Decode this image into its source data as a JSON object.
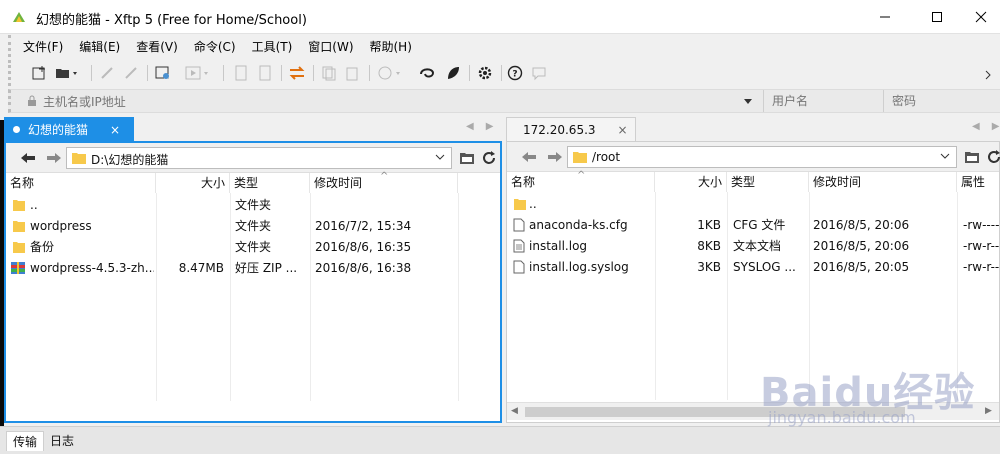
{
  "window": {
    "title": "幻想的能猫 - Xftp 5 (Free for Home/School)"
  },
  "menu": [
    "文件(F)",
    "编辑(E)",
    "查看(V)",
    "命令(C)",
    "工具(T)",
    "窗口(W)",
    "帮助(H)"
  ],
  "address_bar": {
    "host_placeholder": "主机名或IP地址",
    "username_placeholder": "用户名",
    "password_placeholder": "密码"
  },
  "left_pane": {
    "tab_label": "幻想的能猫",
    "tab_close": "×",
    "path": "D:\\幻想的能猫",
    "columns": [
      "名称",
      "大小",
      "类型",
      "修改时间"
    ],
    "files": [
      {
        "name": "..",
        "size": "",
        "type": "文件夹",
        "modified": "",
        "icon": "folder-icon"
      },
      {
        "name": "wordpress",
        "size": "",
        "type": "文件夹",
        "modified": "2016/7/2, 15:34",
        "icon": "folder-icon"
      },
      {
        "name": "备份",
        "size": "",
        "type": "文件夹",
        "modified": "2016/8/6, 16:35",
        "icon": "folder-icon"
      },
      {
        "name": "wordpress-4.5.3-zh...",
        "size": "8.47MB",
        "type": "好压 ZIP ...",
        "modified": "2016/8/6, 16:38",
        "icon": "zip-archive-icon"
      }
    ]
  },
  "right_pane": {
    "tab_label": "172.20.65.3",
    "tab_close": "×",
    "path": "/root",
    "columns": [
      "名称",
      "大小",
      "类型",
      "修改时间",
      "属性"
    ],
    "files": [
      {
        "name": "..",
        "size": "",
        "type": "",
        "modified": "",
        "attr": "",
        "icon": "folder-icon"
      },
      {
        "name": "anaconda-ks.cfg",
        "size": "1KB",
        "type": "CFG 文件",
        "modified": "2016/8/5, 20:06",
        "attr": "-rw-----",
        "icon": "file-icon"
      },
      {
        "name": "install.log",
        "size": "8KB",
        "type": "文本文档",
        "modified": "2016/8/5, 20:06",
        "attr": "-rw-r--",
        "icon": "text-file-icon"
      },
      {
        "name": "install.log.syslog",
        "size": "3KB",
        "type": "SYSLOG ...",
        "modified": "2016/8/5, 20:05",
        "attr": "-rw-r--",
        "icon": "file-icon"
      }
    ]
  },
  "bottom_tabs": [
    "传输",
    "日志"
  ],
  "watermark": {
    "brand": "Baidu经验",
    "url": "jingyan.baidu.com"
  },
  "colors": {
    "accent": "#1e8fe6",
    "online": "#2aa52a",
    "folder": "#f7c94b"
  }
}
